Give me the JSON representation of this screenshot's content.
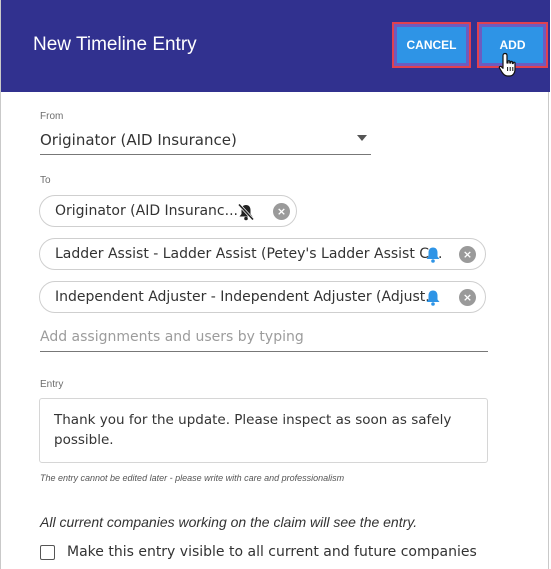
{
  "dialog": {
    "title": "New Timeline Entry",
    "cancel_label": "CANCEL",
    "add_label": "ADD"
  },
  "from": {
    "label": "From",
    "value": "Originator (AID Insurance)"
  },
  "to": {
    "label": "To",
    "chips": [
      {
        "text": "Originator (AID Insuranc...",
        "notification": "bell-off-icon"
      },
      {
        "text": "Ladder Assist - Ladder Assist (Petey's Ladder Assist C...",
        "notification": "bell-icon"
      },
      {
        "text": "Independent Adjuster - Independent Adjuster (Adjust...",
        "notification": "bell-icon"
      }
    ],
    "placeholder": "Add assignments and users by typing"
  },
  "entry": {
    "label": "Entry",
    "value": "Thank you for the update.  Please inspect as soon as safely possible.",
    "hint": "The entry cannot be edited later - please write with care and professionalism"
  },
  "notice": "All current companies working on the claim will see the entry.",
  "visibility_checkbox": {
    "label": "Make this entry visible to all current and future companies",
    "checked": false
  },
  "colors": {
    "header": "#31318f",
    "button": "#2e94e6",
    "highlight_border": "#e0404f",
    "bell": "#2e94e6"
  }
}
